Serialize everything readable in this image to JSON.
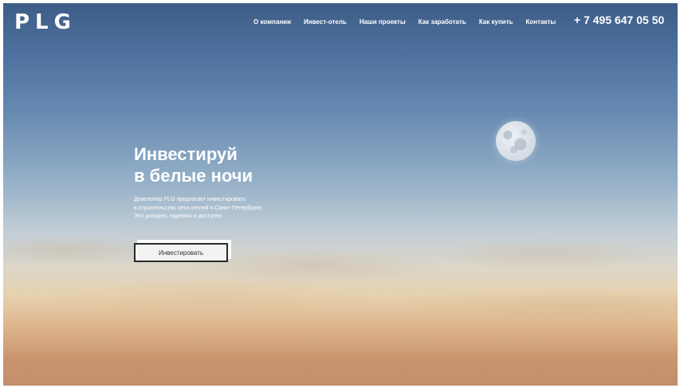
{
  "brand": {
    "logo_text": "PLG"
  },
  "nav": {
    "items": [
      {
        "label": "О компании"
      },
      {
        "label": "Инвест-отель"
      },
      {
        "label": "Наши проекты"
      },
      {
        "label": "Как заработать"
      },
      {
        "label": "Как купить"
      },
      {
        "label": "Контакты"
      }
    ],
    "phone": "+ 7 495 647 05 50"
  },
  "hero": {
    "title_line_1": "Инвестируй",
    "title_line_2": "в белые ночи",
    "description_lines": [
      "Девелопер PLG предлагает инвестировать",
      "в строительство сети отелей в Санкт-Петербурге.",
      "Это доходно, надежно и доступно."
    ],
    "cta_label": "Инвестировать"
  },
  "icons": {
    "moon": "moon-icon"
  },
  "colors": {
    "sky_top": "#3d5d86",
    "sky_middle": "#93afc7",
    "horizon": "#e6d2b0",
    "ground": "#c18e6d",
    "text": "#ffffff",
    "button_border": "#2a2a2a",
    "button_background": "#f3f3f1"
  }
}
